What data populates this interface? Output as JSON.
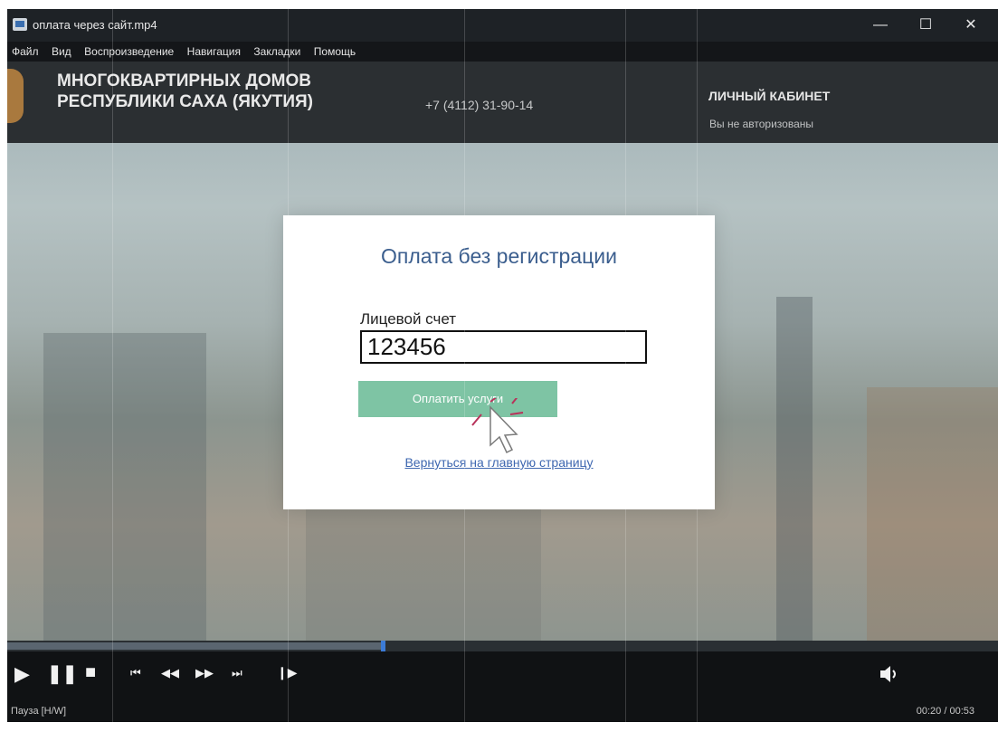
{
  "window": {
    "title": "оплата через сайт.mp4",
    "buttons": {
      "minimize": "—",
      "maximize": "☐",
      "close": "✕"
    }
  },
  "menu": [
    "Файл",
    "Вид",
    "Воспроизведение",
    "Навигация",
    "Закладки",
    "Помощь"
  ],
  "site_header": {
    "org_line1": "МНОГОКВАРТИРНЫХ ДОМОВ",
    "org_line2": "РЕСПУБЛИКИ САХА (ЯКУТИЯ)",
    "phone": "+7 (4112) 31-90-14",
    "cabinet": "ЛИЧНЫЙ КАБИНЕТ",
    "auth_status": "Вы не авторизованы"
  },
  "modal": {
    "title": "Оплата без регистрации",
    "account_label": "Лицевой счет",
    "account_value": "123456",
    "pay_button": "Оплатить услуги",
    "back_link": "Вернуться на главную страницу"
  },
  "player": {
    "progress": 0.377,
    "status": "Пауза [H/W]",
    "time": "00:20 / 00:53",
    "controls": [
      "play",
      "pause",
      "stop",
      "skip-back",
      "rewind",
      "forward",
      "skip-forward",
      "frame-step"
    ]
  },
  "colors": {
    "pay_button": "#7ec4a4",
    "modal_title": "#3b5e8e",
    "link": "#3e67b0",
    "seek_thumb": "#3c7bd6"
  }
}
